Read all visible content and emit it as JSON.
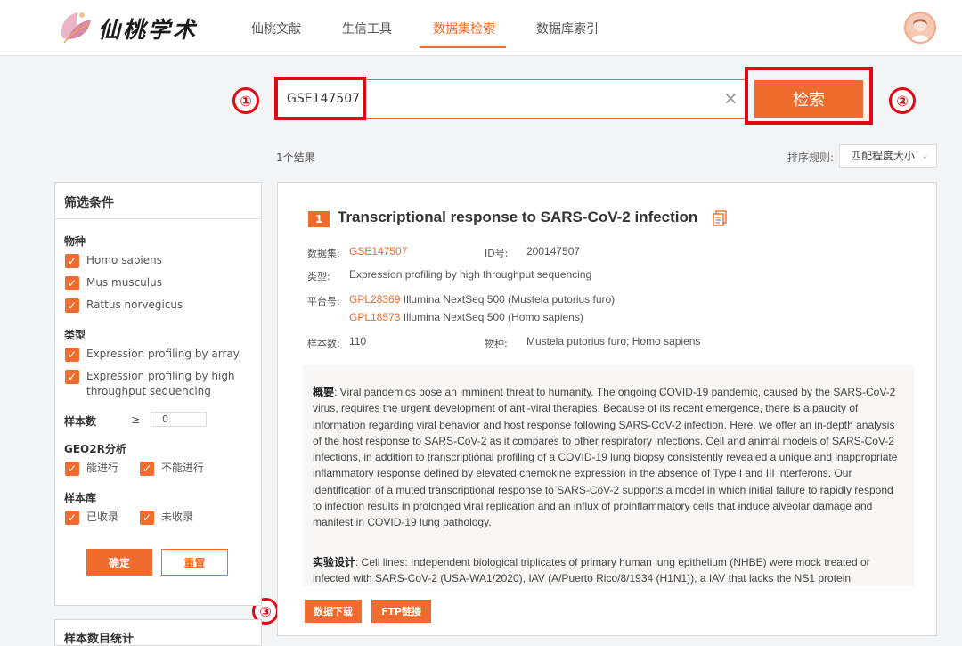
{
  "header": {
    "logo_text": "仙桃学术",
    "nav": [
      "仙桃文献",
      "生信工具",
      "数据集检索",
      "数据库索引"
    ],
    "active_nav": "数据集检索"
  },
  "search": {
    "query": "GSE147507",
    "clear_symbol": "×",
    "button": "检索"
  },
  "markers": [
    "①",
    "②",
    "③"
  ],
  "results": {
    "count_text": "1个结果",
    "sort_label": "排序规则:",
    "sort_value": "匹配程度大小"
  },
  "filter": {
    "title": "筛选条件",
    "species_label": "物种",
    "species": [
      "Homo sapiens",
      "Mus musculus",
      "Rattus norvegicus"
    ],
    "type_label": "类型",
    "types": [
      "Expression profiling by array",
      "Expression profiling by high throughput sequencing"
    ],
    "sample_label": "样本数",
    "sample_op": "≥",
    "sample_value": "0",
    "geo2r_label": "GEO2R分析",
    "geo2r": [
      "能进行",
      "不能进行"
    ],
    "library_label": "样本库",
    "library": [
      "已收录",
      "未收录"
    ],
    "ok": "确定",
    "reset": "重置",
    "next_title": "样本数目统计"
  },
  "card": {
    "rank": "1",
    "title": "Transcriptional response to SARS-CoV-2 infection",
    "dataset_label": "数据集:",
    "dataset": "GSE147507",
    "id_label": "ID号:",
    "id": "200147507",
    "type_label": "类型:",
    "type": "Expression profiling by high throughput sequencing",
    "platform_label": "平台号:",
    "platforms": [
      {
        "id": "GPL28369",
        "desc": "Illumina NextSeq 500 (Mustela putorius furo)"
      },
      {
        "id": "GPL18573",
        "desc": "Illumina NextSeq 500 (Homo sapiens)"
      }
    ],
    "samples_label": "样本数:",
    "samples": "110",
    "species_label": "物种:",
    "species": "Mustela putorius furo; Homo sapiens",
    "summary_label": "概要",
    "summary": ": Viral pandemics pose an imminent threat to humanity. The ongoing COVID-19 pandemic, caused by the SARS-CoV-2 virus, requires the urgent development of anti-viral therapies. Because of its recent emergence, there is a paucity of information regarding viral behavior and host response following SARS-CoV-2 infection. Here, we offer an in-depth analysis of the host response to SARS-CoV-2 as it compares to other respiratory infections. Cell and animal models of SARS-CoV-2 infections, in addition to transcriptional profiling of a COVID-19 lung biopsy consistently revealed a unique and inappropriate inflammatory response defined by elevated chemokine expression in the absence of Type I and III interferons. Our identification of a muted transcriptional response to SARS-CoV-2 supports a model in which initial failure to rapidly respond to infection results in prolonged viral replication and an influx of proinflammatory cells that induce alveolar damage and manifest in COVID-19 lung pathology.",
    "design_label": "实验设计",
    "design": ": Cell lines: Independent biological triplicates of primary human lung epithelium (NHBE) were mock treated or infected with SARS-CoV-2 (USA-WA1/2020), IAV (A/Puerto Rico/8/1934 (H1N1)), a IAV that lacks the NS1 protein",
    "download": "数据下载",
    "ftp": "FTP链接"
  },
  "colors": {
    "accent": "#ef6b2e",
    "annotation_red": "#e30613"
  }
}
